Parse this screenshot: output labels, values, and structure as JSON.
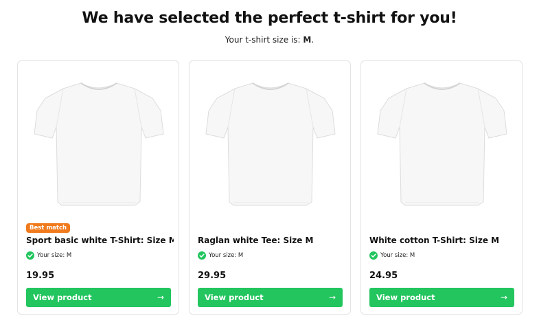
{
  "header": {
    "title": "We have selected the perfect t-shirt for you!",
    "subtitle_prefix": "Your t-shirt size is: ",
    "size": "M",
    "subtitle_suffix": "."
  },
  "colors": {
    "accent_green": "#22c55e",
    "badge_orange": "#f07a1c",
    "check_green": "#22c55e"
  },
  "products": [
    {
      "badge": "Best match",
      "title": "Sport basic white T-Shirt: Size M",
      "size_label": "Your size: M",
      "price": "19.95",
      "button_label": "View product",
      "button_icon": "arrow-right-icon",
      "image": "white-tshirt-image"
    },
    {
      "title": "Raglan white Tee: Size M",
      "size_label": "Your size: M",
      "price": "29.95",
      "button_label": "View product",
      "button_icon": "arrow-right-icon",
      "image": "white-tshirt-image"
    },
    {
      "title": "White cotton T-Shirt: Size M",
      "size_label": "Your size: M",
      "price": "24.95",
      "button_label": "View product",
      "button_icon": "arrow-right-icon",
      "image": "white-tshirt-image"
    }
  ]
}
